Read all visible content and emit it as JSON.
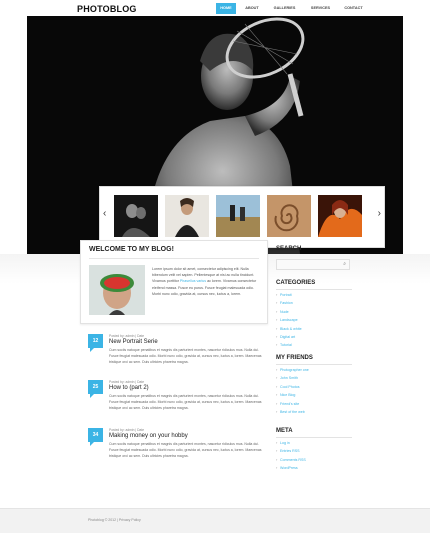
{
  "header": {
    "logo": "PHOTOBLOG",
    "nav": [
      "HOME",
      "ABOUT",
      "GALLERIES",
      "SERVICES",
      "CONTACT"
    ],
    "active_nav": "HOME"
  },
  "slider": {
    "prev_icon": "‹",
    "next_icon": "›",
    "thumbnails": [
      "tennis-couple",
      "woman-portrait",
      "couple-landscape",
      "spiral-sand",
      "fire-woman"
    ]
  },
  "welcome": {
    "title": "WELCOME TO MY BLOG!",
    "text_a": "Lorem ipsum dolor sit amet, consectetur adipiscing elit. Nulla bibendum velit vel sapien. Pellentesque at nisi ac nulla tincidunt. Vivamus porttitor ",
    "link": "Phasellus varius",
    "text_b": " ac lorem. Vivamus consectetur eleifend massa. Fusce eu purus. Fusce feugiat malesuada odio. Morbi nunc odio, gravida at, cursus nec, luctus a, lorem."
  },
  "posts": [
    {
      "day": "12",
      "meta": "Posted by: admin  |  Date",
      "title": "New Portrait Serie",
      "body": "Cum sociis natoque penatibus et magnis dis parturient montes, nascetur ridiculus mus. Nulla dui. Fusce feugiat malesuada odio. Morbi nunc odio, gravida at, cursus nec, luctus a, lorem. Maecenas tristique orci ac sem. Duis ultricies pharetra magna."
    },
    {
      "day": "25",
      "meta": "Posted by: admin  |  Date",
      "title": "How to (part 2)",
      "body": "Cum sociis natoque penatibus et magnis dis parturient montes, nascetur ridiculus mus. Nulla dui. Fusce feugiat malesuada odio. Morbi nunc odio, gravida at, cursus nec, luctus a, lorem. Maecenas tristique orci ac sem. Duis ultricies pharetra magna."
    },
    {
      "day": "34",
      "meta": "Posted by: admin  |  Date",
      "title": "Making money on your hobby",
      "body": "Cum sociis natoque penatibus et magnis dis parturient montes, nascetur ridiculus mus. Nulla dui. Fusce feugiat malesuada odio. Morbi nunc odio, gravida at, cursus nec, luctus a, lorem. Maecenas tristique orci ac sem. Duis ultricies pharetra magna."
    }
  ],
  "sidebar": {
    "search_title": "SEARCH",
    "search_icon": "⌕",
    "categories_title": "CATEGORIES",
    "categories": [
      "Portrait",
      "Fashion",
      "Nude",
      "Landscape",
      "Black & white",
      "Digital art",
      "Tutorial"
    ],
    "friends_title": "MY FRIENDS",
    "friends": [
      "Photographer one",
      "John Smith",
      "Cool Photos",
      "Nice Blog",
      "Friend's site",
      "Best of the web"
    ],
    "meta_title": "META",
    "meta": [
      "Log in",
      "Entries RSS",
      "Comments RSS",
      "WordPress"
    ]
  },
  "footer": {
    "copyright": "Photoblog © 2012 | Privacy Policy"
  },
  "colors": {
    "accent": "#3bb4e5",
    "hero_bg": "#080808"
  }
}
